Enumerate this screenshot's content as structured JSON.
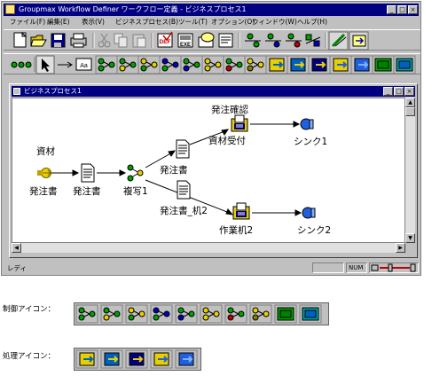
{
  "app": {
    "title": "Groupmax Workflow Definer ワークフロー定義 - ビジネスプロセス1",
    "window_buttons": {
      "minimize": "_",
      "maximize": "□",
      "close": "×"
    }
  },
  "menu": [
    "ファイル(F)",
    "編集(E)",
    "表示(V)",
    "ビジネスプロセス(B)",
    "ツール(T)",
    "オプション(O)",
    "ウィンドウ(W)",
    "ヘルプ(H)"
  ],
  "toolbar1": [
    {
      "icon": "new-file-icon"
    },
    {
      "icon": "open-folder-icon"
    },
    {
      "icon": "save-icon"
    },
    {
      "icon": "print-icon"
    },
    {
      "icon": "cut-icon"
    },
    {
      "icon": "copy-icon"
    },
    {
      "icon": "paste-icon"
    },
    {
      "icon": "def-check-icon",
      "text": "DEF"
    },
    {
      "icon": "exe-icon",
      "text": "EXE"
    },
    {
      "icon": "message-icon"
    },
    {
      "icon": "property-icon"
    },
    {
      "icon": "flow-up-icon"
    },
    {
      "icon": "flow-down-icon"
    },
    {
      "icon": "flow-sync-icon"
    },
    {
      "icon": "flow-branch-icon"
    },
    {
      "icon": "pen-icon"
    },
    {
      "icon": "import-icon"
    }
  ],
  "toolbar2": [
    {
      "icon": "sequence-icon"
    },
    {
      "icon": "select-arrow-icon"
    },
    {
      "icon": "connect-arrow-icon"
    },
    {
      "icon": "label-icon",
      "text": "Aa"
    },
    {
      "icon": "control-1-icon"
    },
    {
      "icon": "control-2-icon"
    },
    {
      "icon": "control-3-icon"
    },
    {
      "icon": "control-4-icon"
    },
    {
      "icon": "control-5-icon"
    },
    {
      "icon": "control-6-icon"
    },
    {
      "icon": "control-7-icon"
    },
    {
      "icon": "control-8-icon"
    },
    {
      "icon": "process-1-icon"
    },
    {
      "icon": "process-2-icon"
    },
    {
      "icon": "process-3-icon"
    },
    {
      "icon": "process-4-icon"
    },
    {
      "icon": "process-5-icon"
    },
    {
      "icon": "control-9-icon"
    },
    {
      "icon": "control-10-icon"
    }
  ],
  "document": {
    "title": "ビジネスプロセス1",
    "nodes": {
      "material": "資材",
      "order_source": "発注書",
      "order_doc1": "発注書",
      "copy": "複写1",
      "order_doc2": "発注書",
      "order_doc3": "発注書_机2",
      "confirm": "発注確認",
      "material_receive": "資材受付",
      "sink1": "シンク1",
      "desk2": "作業机2",
      "sink2": "シンク2"
    }
  },
  "status": {
    "text": "レディ",
    "num": "NUM"
  },
  "legend": {
    "control_label": "制御アイコン：",
    "process_label": "処理アイコン：",
    "control_icons": [
      "control-1-icon",
      "control-2-icon",
      "control-3-icon",
      "control-4-icon",
      "control-5-icon",
      "control-6-icon",
      "control-7-icon",
      "control-8-icon",
      "control-9-icon",
      "control-10-icon"
    ],
    "process_icons": [
      "process-1-icon",
      "process-2-icon",
      "process-3-icon",
      "process-4-icon",
      "process-5-icon"
    ]
  },
  "colors": {
    "titlebar": "#000080",
    "face": "#c0c0c0",
    "connector": "#000000",
    "sink_blue": "#2060e0",
    "start_yellow": "#e8d000"
  }
}
